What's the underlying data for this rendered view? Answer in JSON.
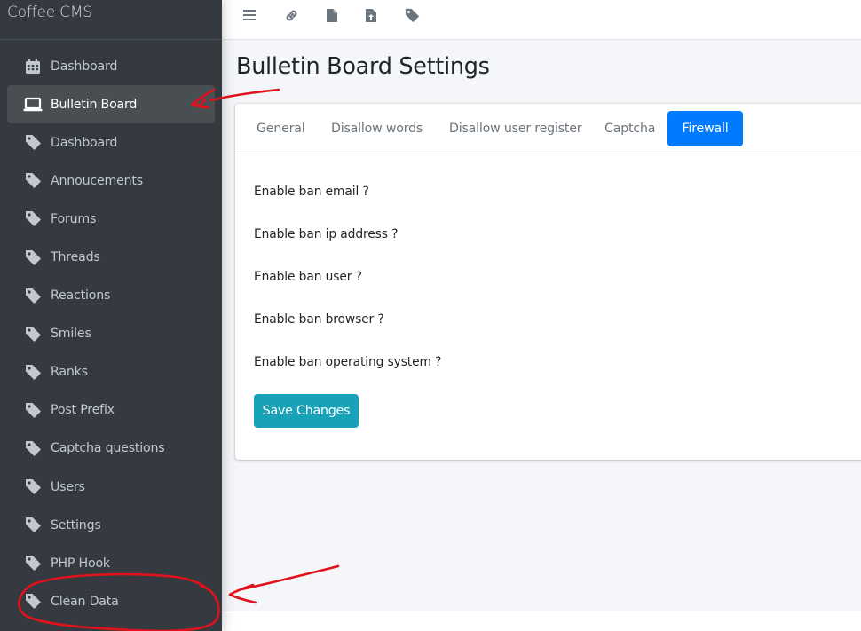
{
  "brand": {
    "title": "Coffee CMS"
  },
  "sidebar": {
    "items": [
      {
        "label": "Dashboard",
        "icon": "calendar-icon",
        "active": false
      },
      {
        "label": "Bulletin Board",
        "icon": "laptop-icon",
        "active": true
      },
      {
        "label": "Dashboard",
        "icon": "tag-icon",
        "active": false
      },
      {
        "label": "Annoucements",
        "icon": "tag-icon",
        "active": false
      },
      {
        "label": "Forums",
        "icon": "tag-icon",
        "active": false
      },
      {
        "label": "Threads",
        "icon": "tag-icon",
        "active": false
      },
      {
        "label": "Reactions",
        "icon": "tag-icon",
        "active": false
      },
      {
        "label": "Smiles",
        "icon": "tag-icon",
        "active": false
      },
      {
        "label": "Ranks",
        "icon": "tag-icon",
        "active": false
      },
      {
        "label": "Post Prefix",
        "icon": "tag-icon",
        "active": false
      },
      {
        "label": "Captcha questions",
        "icon": "tag-icon",
        "active": false
      },
      {
        "label": "Users",
        "icon": "tag-icon",
        "active": false
      },
      {
        "label": "Settings",
        "icon": "tag-icon",
        "active": false
      },
      {
        "label": "PHP Hook",
        "icon": "tag-icon",
        "active": false
      },
      {
        "label": "Clean Data",
        "icon": "tag-icon",
        "active": false
      }
    ]
  },
  "topbar": {
    "icons": [
      "menu-icon",
      "link-icon",
      "file-icon",
      "file-upload-icon",
      "tag-icon"
    ]
  },
  "page": {
    "title": "Bulletin Board Settings"
  },
  "tabs": [
    {
      "label": "General",
      "active": false
    },
    {
      "label": "Disallow words",
      "active": false
    },
    {
      "label": "Disallow user register",
      "active": false
    },
    {
      "label": "Captcha",
      "active": false
    },
    {
      "label": "Firewall",
      "active": true
    }
  ],
  "firewall": {
    "fields": [
      "Enable ban email ?",
      "Enable ban ip address ?",
      "Enable ban user ?",
      "Enable ban browser ?",
      "Enable ban operating system ?"
    ],
    "save_label": "Save Changes"
  },
  "colors": {
    "sidebar_bg": "#343a40",
    "active_tab": "#007bff",
    "save_button": "#17a2b8",
    "annotation": "#e0121b"
  }
}
